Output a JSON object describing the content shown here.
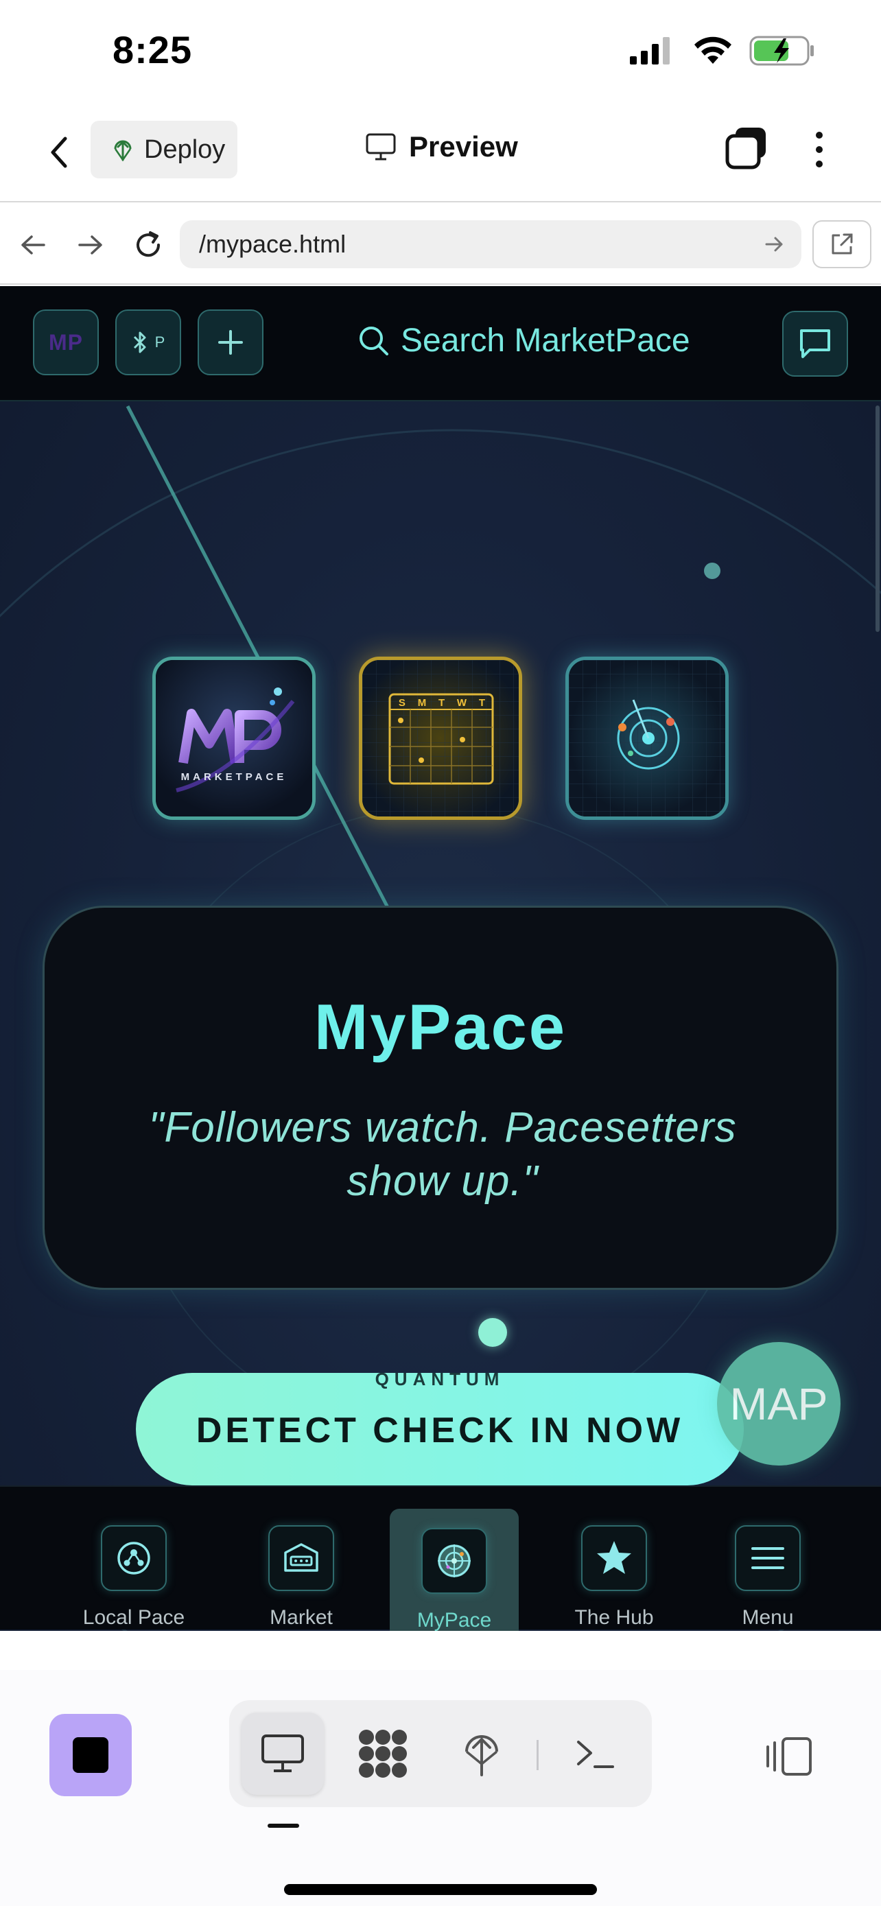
{
  "status_bar": {
    "time": "8:25"
  },
  "app_bar": {
    "deploy_label": "Deploy",
    "preview_label": "Preview"
  },
  "url_bar": {
    "url": "/mypace.html"
  },
  "site": {
    "header": {
      "mp_badge": "MP",
      "p_badge": "P",
      "search_label": "Search MarketPace"
    },
    "tiles": {
      "marketpace_logo_text": "MARKETPACE",
      "calendar_days": [
        "S",
        "M",
        "T",
        "W",
        "T"
      ]
    },
    "hero": {
      "title": "MyPace",
      "quote": "\"Followers watch. Pacesetters show up.\""
    },
    "cta": {
      "sub_label": "QUANTUM",
      "label": "DETECT CHECK IN NOW"
    },
    "map_button": "MAP",
    "nav": [
      {
        "label": "Local Pace",
        "icon": "local-pace-icon",
        "active": false
      },
      {
        "label": "Market",
        "icon": "market-icon",
        "active": false
      },
      {
        "label": "MyPace",
        "icon": "radar-icon",
        "active": true
      },
      {
        "label": "The Hub",
        "icon": "star-icon",
        "active": false
      },
      {
        "label": "Menu",
        "icon": "menu-icon",
        "active": false
      }
    ]
  },
  "colors": {
    "accent": "#6ef0ea",
    "cta_gradient_start": "#8ff5d6",
    "cta_gradient_end": "#7ef5f0",
    "stop_button": "#b9a4f7"
  }
}
